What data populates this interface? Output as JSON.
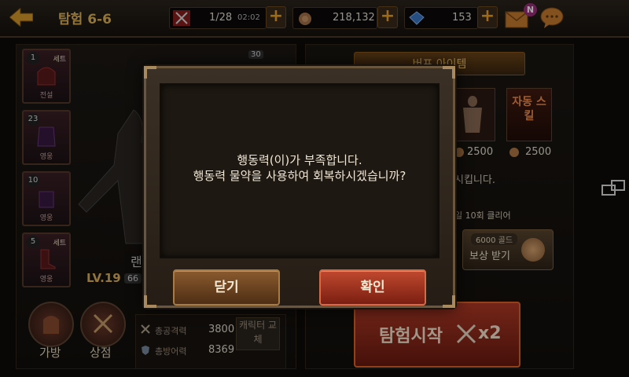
{
  "header": {
    "title": "탐험 6-6",
    "stamina": "1/28",
    "stamina_timer": "02:02",
    "gold": "218,132",
    "gems": "153",
    "mail_badge": "N"
  },
  "equipment": [
    {
      "level": "1",
      "tag": "세트",
      "name": "전설"
    },
    {
      "level": "23",
      "tag": "",
      "name": "영웅"
    },
    {
      "level": "10",
      "tag": "",
      "name": "영웅"
    },
    {
      "level": "5",
      "tag": "세트",
      "name": "영웅"
    }
  ],
  "character": {
    "name": "랜",
    "level": "LV.19",
    "level_extra": "66"
  },
  "bottom_nav": {
    "bag": "가방",
    "shop": "상점"
  },
  "stats": {
    "attack_label": "총공격력",
    "attack_value": "3800",
    "defense_label": "총방어력",
    "defense_value": "8369",
    "swap_label": "캐릭터 교체"
  },
  "buff": {
    "tab_label": "버프 아이템",
    "item_badge": "30",
    "auto_skill": "자동 스킬",
    "price_1": "2500",
    "price_2": "2500",
    "desc_fragment": "시킵니다.",
    "quest": "일 10회 클리어",
    "reward_gold": "6000 골드",
    "reward_label": "보상 받기"
  },
  "explore": {
    "label": "탐험시작",
    "multiplier": "x2"
  },
  "dialog": {
    "line1": "행동력(이)가 부족합니다.",
    "line2": "행동력 물약을 사용하여 회복하시겠습니까?",
    "close_label": "닫기",
    "confirm_label": "확인"
  }
}
